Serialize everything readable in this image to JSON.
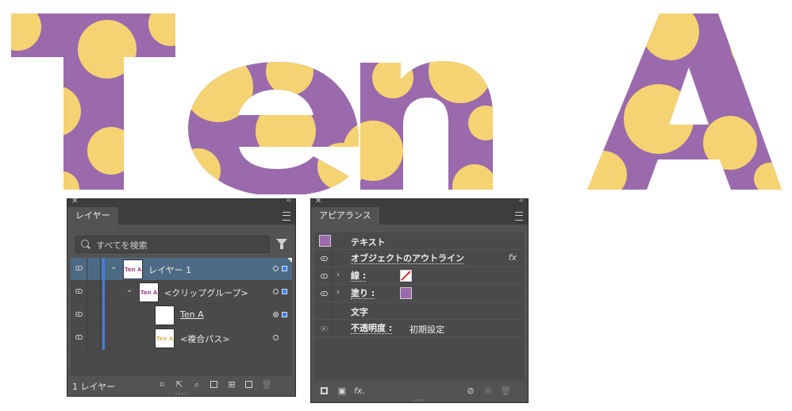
{
  "artwork": {
    "text": "Ten A",
    "letters": [
      "T",
      "e",
      "n",
      "A"
    ],
    "fill_color": "#9a6aac",
    "dot_color": "#f5d372"
  },
  "layers_panel": {
    "tab": "レイヤー",
    "search_placeholder": "すべてを検索",
    "rows": [
      {
        "name": "レイヤー 1",
        "thumb": "Ten A",
        "selected": true
      },
      {
        "name": "<クリップグループ>",
        "thumb": "Ten A",
        "selected": false
      },
      {
        "name": "Ten A",
        "thumb": "",
        "selected": false
      },
      {
        "name": "<複合パス>",
        "thumb": "Ten A",
        "selected": false
      }
    ],
    "layer_count": "1 レイヤー",
    "accent": "#3d7fe8",
    "selection_color": "#4d6a85"
  },
  "appearance_panel": {
    "tab": "アピアランス",
    "object_type": "テキスト",
    "outline_label": "オブジェクトのアウトライン",
    "fx_label": "fx",
    "stroke_label": "線 :",
    "fill_label": "塗り :",
    "fill_swatch": "#9a6aac",
    "characters_label": "文字",
    "opacity_label": "不透明度 :",
    "opacity_value": "初期設定",
    "footer_fx": "fx."
  }
}
